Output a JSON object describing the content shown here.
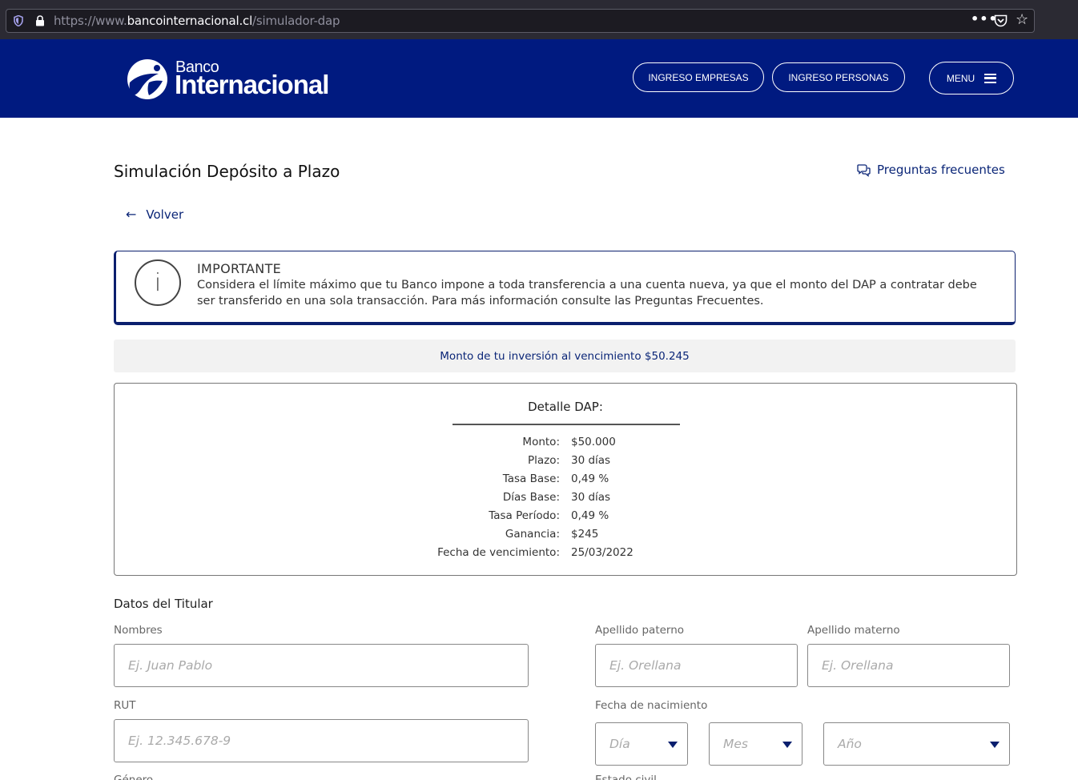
{
  "browser": {
    "url_prefix": "https://www.",
    "url_domain": "bancointernacional.cl",
    "url_path": "/simulador-dap",
    "more_glyph": "•••",
    "star_glyph": "☆"
  },
  "header": {
    "logo_small": "Banco",
    "logo_big": "Internacional",
    "btn_empresas": "INGRESO EMPRESAS",
    "btn_personas": "INGRESO PERSONAS",
    "btn_menu": "MENU"
  },
  "page": {
    "title": "Simulación Depósito a Plazo",
    "faq_label": "Preguntas frecuentes",
    "back_label": "Volver",
    "back_arrow": "←"
  },
  "important": {
    "icon_glyph": "i",
    "title": "IMPORTANTE",
    "text": "Considera el límite máximo que tu Banco impone a toda transferencia a una cuenta nueva, ya que el monto del DAP a contratar debe ser transferido en una sola transacción. Para más información consulte las Preguntas Frecuentes."
  },
  "monto_banner": "Monto de tu inversión al vencimiento $50.245",
  "detalle": {
    "title": "Detalle DAP:",
    "rows": [
      {
        "label": "Monto:",
        "value": "$50.000"
      },
      {
        "label": "Plazo:",
        "value": "30 días"
      },
      {
        "label": "Tasa Base:",
        "value": "0,49 %"
      },
      {
        "label": "Días Base:",
        "value": "30 días"
      },
      {
        "label": "Tasa Período:",
        "value": "0,49 %"
      },
      {
        "label": "Ganancia:",
        "value": "$245"
      },
      {
        "label": "Fecha de vencimiento:",
        "value": "25/03/2022"
      }
    ]
  },
  "form": {
    "section_title": "Datos del Titular",
    "nombres_label": "Nombres",
    "nombres_placeholder": "Ej. Juan Pablo",
    "ap_paterno_label": "Apellido paterno",
    "ap_paterno_placeholder": "Ej. Orellana",
    "ap_materno_label": "Apellido materno",
    "ap_materno_placeholder": "Ej. Orellana",
    "rut_label": "RUT",
    "rut_placeholder": "Ej. 12.345.678-9",
    "fecha_label": "Fecha de nacimiento",
    "dia_placeholder": "Día",
    "mes_placeholder": "Mes",
    "anio_placeholder": "Año",
    "cut_label_left": "Género",
    "cut_label_right": "Estado civil"
  },
  "colors": {
    "brand_navy": "#001a80",
    "link_blue": "#0a2577"
  }
}
